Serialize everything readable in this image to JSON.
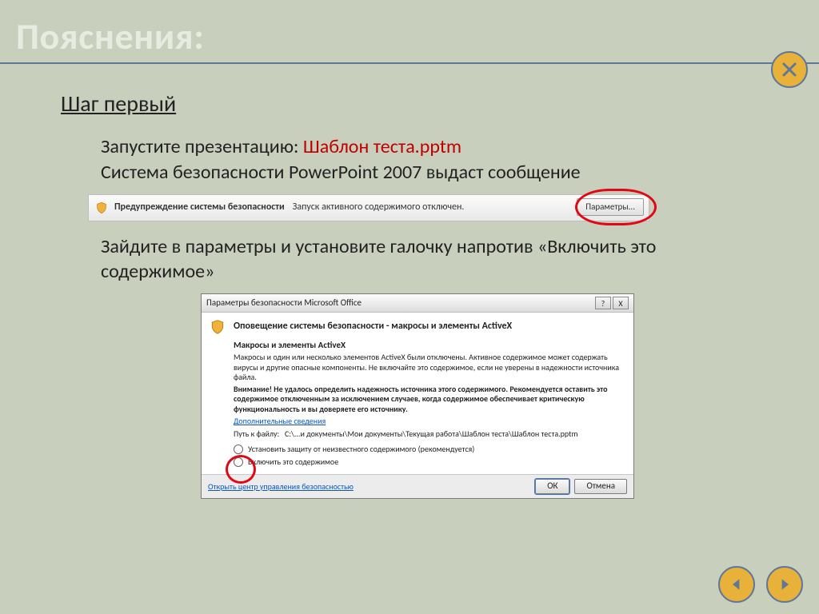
{
  "slide": {
    "title": "Пояснения:",
    "step_heading": "Шаг первый",
    "p1_prefix": "Запустите презентацию: ",
    "p1_file": "Шаблон теста.pptm",
    "p1_line2": "Система безопасности PowerPoint 2007 выдаст сообщение",
    "p2": "Зайдите в параметры и установите галочку напротив «Включить это содержимое»"
  },
  "security_bar": {
    "bold": "Предупреждение системы безопасности",
    "text": "Запуск активного содержимого отключен.",
    "button": "Параметры..."
  },
  "dialog": {
    "title": "Параметры безопасности Microsoft Office",
    "help": "?",
    "close": "X",
    "header": "Оповещение системы безопасности - макросы и элементы ActiveX",
    "sec_heading": "Макросы и элементы ActiveX",
    "sec_p1": "Макросы и один или несколько элементов ActiveX были отключены. Активное содержимое может содержать вирусы и другие опасные компоненты. Не включайте это содержимое, если не уверены в надежности источника файла.",
    "sec_p2": "Внимание! Не удалось определить надежность источника этого содержимого. Рекомендуется оставить это содержимое отключенным за исключением случаев, когда содержимое обеспечивает критическую функциональность и вы доверяете его источнику.",
    "more_link": "Дополнительные сведения",
    "path_label": "Путь к файлу:",
    "path_value": "C:\\...и документы\\Мои документы\\Текущая работа\\Шаблон теста\\Шаблон теста.pptm",
    "radio1": "Установить защиту от неизвестного содержимого (рекомендуется)",
    "radio2": "Включить это содержимое",
    "trust_center_link": "Открыть центр управления безопасностью",
    "ok": "ОК",
    "cancel": "Отмена"
  }
}
